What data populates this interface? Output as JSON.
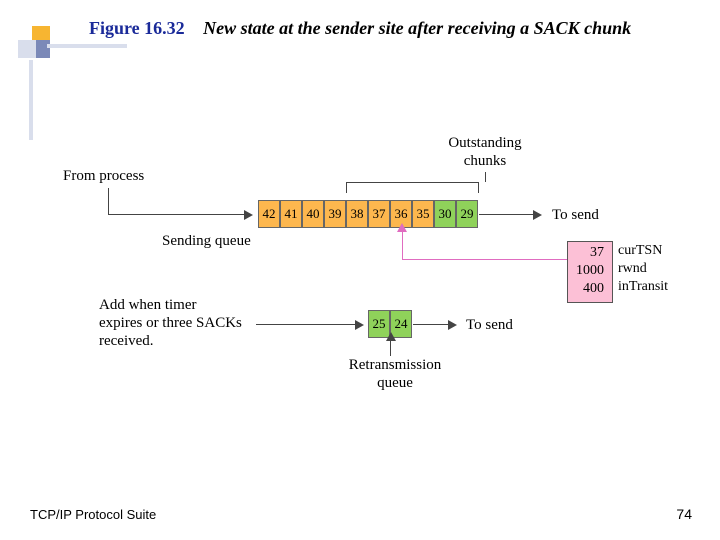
{
  "title": {
    "figure_no": "Figure 16.32",
    "caption": "New state at the sender site after receiving a SACK chunk"
  },
  "labels": {
    "from_process": "From process",
    "sending_queue": "Sending queue",
    "outstanding": "Outstanding\nchunks",
    "to_send_1": "To send",
    "add_timer": "Add when timer\nexpires or three SACKs\nreceived.",
    "retrans_queue": "Retransmission\nqueue",
    "to_send_2": "To send"
  },
  "sending_cells": [
    "42",
    "41",
    "40",
    "39",
    "38",
    "37",
    "36",
    "35",
    "30",
    "29"
  ],
  "sending_colors": [
    "orange",
    "orange",
    "orange",
    "orange",
    "orange",
    "orange",
    "orange",
    "orange",
    "green",
    "green"
  ],
  "retrans_cells": [
    "25",
    "24"
  ],
  "retrans_colors": [
    "green",
    "green"
  ],
  "outstanding_range": [
    4,
    9
  ],
  "state_box": {
    "curTSN": "37",
    "rwnd": "1000",
    "inTransit": "400"
  },
  "state_keys": {
    "curTSN": "curTSN",
    "rwnd": "rwnd",
    "inTransit": "inTransit"
  },
  "footer": {
    "left": "TCP/IP Protocol Suite",
    "right": "74"
  }
}
